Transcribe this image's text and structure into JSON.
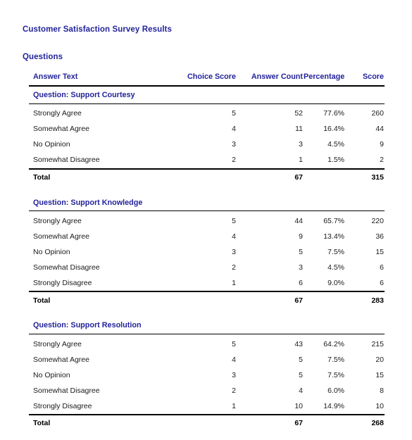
{
  "document": {
    "report_title": "Customer Satisfaction Survey Results",
    "section_title": "Questions",
    "accent_color": "#23239b",
    "rule_color": "#000000"
  },
  "table": {
    "columns": [
      {
        "key": "answer_text",
        "label": "Answer Text",
        "align": "left"
      },
      {
        "key": "choice_score",
        "label": "Choice Score",
        "align": "right"
      },
      {
        "key": "answer_count",
        "label": "Answer Count",
        "align": "right"
      },
      {
        "key": "percentage",
        "label": "Percentage",
        "align": "right"
      },
      {
        "key": "score",
        "label": "Score",
        "align": "right"
      }
    ],
    "total_label": "Total",
    "groups": [
      {
        "heading": "Question: Support Courtesy",
        "rows": [
          {
            "answer_text": "Strongly Agree",
            "choice_score": "5",
            "answer_count": "52",
            "percentage": "77.6%",
            "score": "260"
          },
          {
            "answer_text": "Somewhat Agree",
            "choice_score": "4",
            "answer_count": "11",
            "percentage": "16.4%",
            "score": "44"
          },
          {
            "answer_text": "No Opinion",
            "choice_score": "3",
            "answer_count": "3",
            "percentage": "4.5%",
            "score": "9"
          },
          {
            "answer_text": "Somewhat Disagree",
            "choice_score": "2",
            "answer_count": "1",
            "percentage": "1.5%",
            "score": "2"
          }
        ],
        "total": {
          "answer_text": "Total",
          "choice_score": "",
          "answer_count": "67",
          "percentage": "",
          "score": "315"
        }
      },
      {
        "heading": "Question: Support Knowledge",
        "rows": [
          {
            "answer_text": "Strongly Agree",
            "choice_score": "5",
            "answer_count": "44",
            "percentage": "65.7%",
            "score": "220"
          },
          {
            "answer_text": "Somewhat Agree",
            "choice_score": "4",
            "answer_count": "9",
            "percentage": "13.4%",
            "score": "36"
          },
          {
            "answer_text": "No Opinion",
            "choice_score": "3",
            "answer_count": "5",
            "percentage": "7.5%",
            "score": "15"
          },
          {
            "answer_text": "Somewhat Disagree",
            "choice_score": "2",
            "answer_count": "3",
            "percentage": "4.5%",
            "score": "6"
          },
          {
            "answer_text": "Strongly Disagree",
            "choice_score": "1",
            "answer_count": "6",
            "percentage": "9.0%",
            "score": "6"
          }
        ],
        "total": {
          "answer_text": "Total",
          "choice_score": "",
          "answer_count": "67",
          "percentage": "",
          "score": "283"
        }
      },
      {
        "heading": "Question: Support Resolution",
        "rows": [
          {
            "answer_text": "Strongly Agree",
            "choice_score": "5",
            "answer_count": "43",
            "percentage": "64.2%",
            "score": "215"
          },
          {
            "answer_text": "Somewhat Agree",
            "choice_score": "4",
            "answer_count": "5",
            "percentage": "7.5%",
            "score": "20"
          },
          {
            "answer_text": "No Opinion",
            "choice_score": "3",
            "answer_count": "5",
            "percentage": "7.5%",
            "score": "15"
          },
          {
            "answer_text": "Somewhat Disagree",
            "choice_score": "2",
            "answer_count": "4",
            "percentage": "6.0%",
            "score": "8"
          },
          {
            "answer_text": "Strongly Disagree",
            "choice_score": "1",
            "answer_count": "10",
            "percentage": "14.9%",
            "score": "10"
          }
        ],
        "total": {
          "answer_text": "Total",
          "choice_score": "",
          "answer_count": "67",
          "percentage": "",
          "score": "268"
        }
      }
    ]
  }
}
